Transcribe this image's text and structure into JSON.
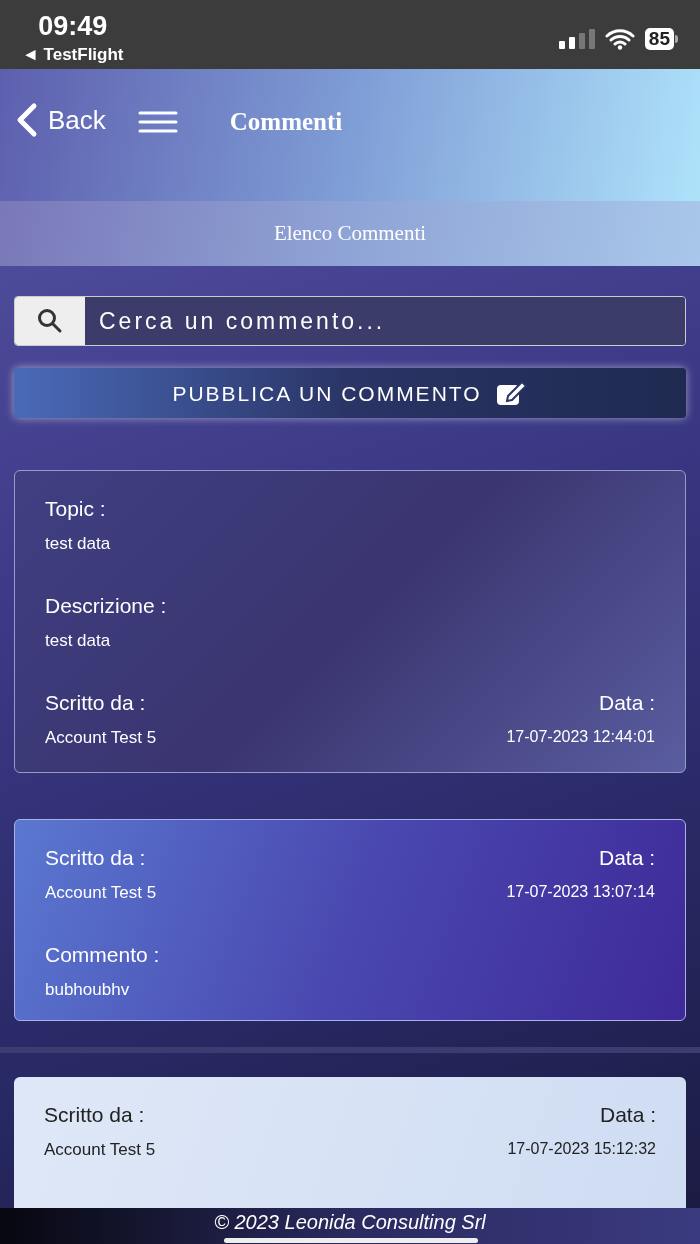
{
  "status_bar": {
    "time": "09:49",
    "back_app": "◄ TestFlight",
    "battery": "85"
  },
  "header": {
    "back": "Back",
    "title": "Commenti"
  },
  "subheader": "Elenco Commenti",
  "search": {
    "placeholder": "Cerca un commento..."
  },
  "publish_button": "PUBBLICA UN COMMENTO",
  "cards": [
    {
      "kind": "topic",
      "rows": [
        {
          "kind": "field",
          "label": "Topic :",
          "value": "test data"
        },
        {
          "kind": "field",
          "label": "Descrizione :",
          "value": "test data"
        },
        {
          "kind": "meta",
          "left_label": "Scritto da :",
          "left_value": "Account Test 5",
          "right_label": "Data :",
          "right_value": "17-07-2023 12:44:01"
        }
      ]
    },
    {
      "kind": "comment",
      "rows": [
        {
          "kind": "meta",
          "left_label": "Scritto da :",
          "left_value": "Account Test 5",
          "right_label": "Data :",
          "right_value": "17-07-2023 13:07:14"
        },
        {
          "kind": "field",
          "label": "Commento :",
          "value": "bubhoubhv"
        }
      ]
    },
    {
      "kind": "light",
      "rows": [
        {
          "kind": "meta",
          "left_label": "Scritto da :",
          "left_value": "Account Test 5",
          "right_label": "Data :",
          "right_value": "17-07-2023 15:12:32"
        }
      ]
    }
  ],
  "footer": "© 2023 Leonida Consulting Srl"
}
